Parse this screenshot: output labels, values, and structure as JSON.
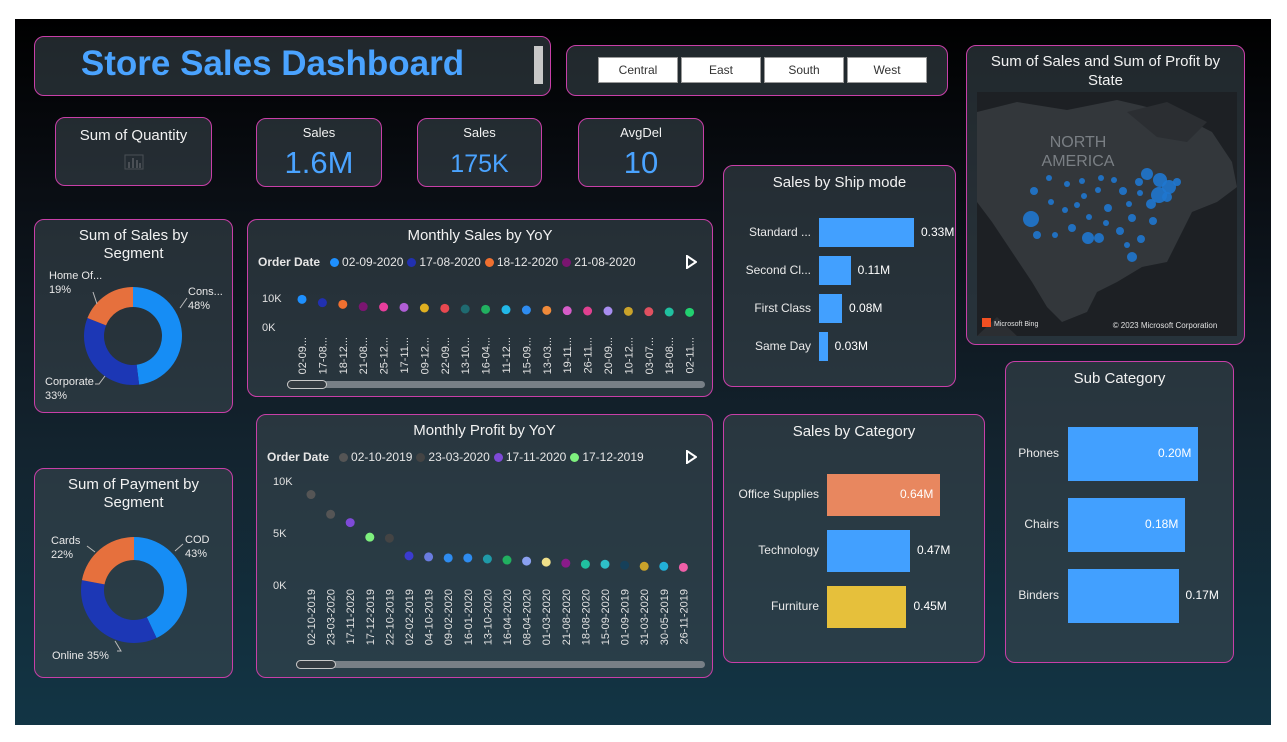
{
  "dashboard": {
    "title": "Store Sales Dashboard",
    "slicer": [
      "Central",
      "East",
      "South",
      "West"
    ],
    "kpis": [
      {
        "label": "Sum of Quantity",
        "value": ""
      },
      {
        "label": "Sales",
        "value": "1.6M"
      },
      {
        "label": "Sales",
        "value": "175K"
      },
      {
        "label": "AvgDel",
        "value": "10"
      }
    ],
    "colors": {
      "accent": "#4aa3ff",
      "border": "#c83fa8",
      "orange": "#f08a5d",
      "yellow": "#e6c03b"
    }
  },
  "map": {
    "title": "Sum of Sales and Sum of Profit by State",
    "region_label_1": "NORTH",
    "region_label_2": "AMERICA",
    "bing": "Microsoft Bing",
    "copyright": "© 2023 Microsoft Corporation"
  },
  "chart_data": [
    {
      "type": "pie",
      "title": "Sum of Sales by Segment",
      "labels": [
        "Cons...",
        "Corporate",
        "Home Of..."
      ],
      "values": [
        48,
        33,
        19
      ],
      "value_labels": [
        "48%",
        "33%",
        "19%"
      ],
      "colors": [
        "#168df5",
        "#1c37b5",
        "#e6703d"
      ]
    },
    {
      "type": "pie",
      "title": "Sum of Payment by Segment",
      "labels": [
        "COD",
        "Online",
        "Cards"
      ],
      "values": [
        43,
        35,
        22
      ],
      "value_labels": [
        "43%",
        "Online 35%",
        "22%"
      ],
      "colors": [
        "#168df5",
        "#1c37b5",
        "#e6703d"
      ]
    },
    {
      "type": "scatter",
      "title": "Monthly Sales by YoY",
      "legend_title": "Order Date",
      "legend": [
        {
          "name": "02-09-2020",
          "color": "#1e90ff"
        },
        {
          "name": "17-08-2020",
          "color": "#2130b0"
        },
        {
          "name": "18-12-2020",
          "color": "#f07030"
        },
        {
          "name": "21-08-2020",
          "color": "#7a1570"
        }
      ],
      "yticks": [
        "10K",
        "0K"
      ],
      "x": [
        "02-09...",
        "17-08...",
        "18-12...",
        "21-08...",
        "25-12...",
        "17-11...",
        "09-12...",
        "22-09...",
        "13-10...",
        "16-04...",
        "11-12...",
        "15-09...",
        "13-03...",
        "19-11...",
        "26-11...",
        "20-09...",
        "10-12...",
        "03-07...",
        "18-08...",
        "02-11..."
      ],
      "y": [
        9.5,
        8.5,
        8.0,
        7.3,
        7.2,
        7.1,
        6.9,
        6.8,
        6.6,
        6.5,
        6.4,
        6.3,
        6.2,
        6.1,
        6.0,
        6.0,
        5.9,
        5.8,
        5.7,
        5.6
      ],
      "colors": [
        "#1e90ff",
        "#2130b0",
        "#f07030",
        "#7a1570",
        "#e83e9c",
        "#b05ed6",
        "#e0b020",
        "#e84850",
        "#1f6a70",
        "#21b060",
        "#22b8e8",
        "#2e8cf0",
        "#f08a3a",
        "#d65cc8",
        "#e04090",
        "#a88df0",
        "#c9a22a",
        "#e05060",
        "#20c0a0",
        "#22d070"
      ]
    },
    {
      "type": "scatter",
      "title": "Monthly Profit by YoY",
      "legend_title": "Order Date",
      "legend": [
        {
          "name": "02-10-2019",
          "color": "#555555"
        },
        {
          "name": "23-03-2020",
          "color": "#444444"
        },
        {
          "name": "17-11-2020",
          "color": "#7e4ad8"
        },
        {
          "name": "17-12-2019",
          "color": "#7ef07e"
        }
      ],
      "yticks": [
        "10K",
        "5K",
        "0K"
      ],
      "ylim": [
        0,
        10
      ],
      "x": [
        "02-10-2019",
        "23-03-2020",
        "17-11-2020",
        "17-12-2019",
        "22-10-2019",
        "02-02-2019",
        "04-10-2019",
        "09-02-2020",
        "16-01-2020",
        "13-10-2020",
        "16-04-2020",
        "08-04-2020",
        "01-03-2020",
        "21-08-2020",
        "18-08-2020",
        "15-09-2020",
        "01-09-2019",
        "31-03-2020",
        "30-05-2019",
        "26-11-2019"
      ],
      "y": [
        8.7,
        6.8,
        6.0,
        4.6,
        4.5,
        2.8,
        2.7,
        2.6,
        2.6,
        2.5,
        2.4,
        2.3,
        2.2,
        2.1,
        2.0,
        2.0,
        1.9,
        1.8,
        1.8,
        1.7
      ],
      "colors": [
        "#555555",
        "#555555",
        "#7e4ad8",
        "#7ef07e",
        "#444444",
        "#3b3bd0",
        "#6a7ce0",
        "#2e8cf0",
        "#2e8cf0",
        "#1f9aa8",
        "#21b060",
        "#8aa0f0",
        "#f0e08a",
        "#8a1b8a",
        "#20c0a0",
        "#2ec0c8",
        "#16405a",
        "#c9a22a",
        "#22b0d8",
        "#f05fa8"
      ]
    },
    {
      "type": "bar",
      "title": "Sales by Ship mode",
      "categories": [
        "Standard ...",
        "Second Cl...",
        "First Class",
        "Same Day"
      ],
      "values": [
        0.33,
        0.11,
        0.08,
        0.03
      ],
      "value_labels": [
        "0.33M",
        "0.11M",
        "0.08M",
        "0.03M"
      ]
    },
    {
      "type": "bar",
      "title": "Sales by Category",
      "categories": [
        "Office Supplies",
        "Technology",
        "Furniture"
      ],
      "values": [
        0.64,
        0.47,
        0.45
      ],
      "value_labels": [
        "0.64M",
        "0.47M",
        "0.45M"
      ],
      "colors": [
        "#e8875f",
        "#42a0ff",
        "#e6c03b"
      ]
    },
    {
      "type": "bar",
      "title": "Sub Category",
      "categories": [
        "Phones",
        "Chairs",
        "Binders"
      ],
      "values": [
        0.2,
        0.18,
        0.17
      ],
      "value_labels": [
        "0.20M",
        "0.18M",
        "0.17M"
      ]
    }
  ]
}
